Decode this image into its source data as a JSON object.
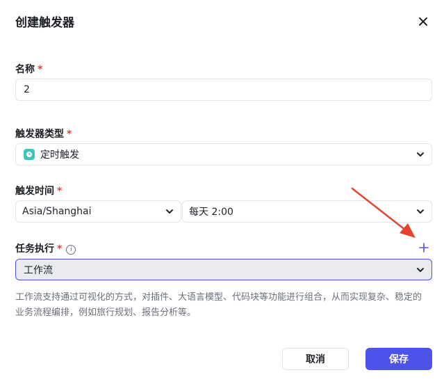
{
  "dialog": {
    "title": "创建触发器",
    "close_icon": "close-icon"
  },
  "form": {
    "name": {
      "label": "名称",
      "required_mark": "*",
      "value": "2"
    },
    "trigger_type": {
      "label": "触发器类型",
      "required_mark": "*",
      "selected": "定时触发",
      "icon": "clock-icon",
      "icon_color": "#3fc6b8"
    },
    "trigger_time": {
      "label": "触发时间",
      "required_mark": "*",
      "timezone": "Asia/Shanghai",
      "schedule": "每天 2:00"
    },
    "task": {
      "label": "任务执行",
      "required_mark": "*",
      "info_icon": "info-icon",
      "add_icon": "plus-icon",
      "selected": "工作流",
      "description": "工作流支持通过可视化的方式，对插件、大语言模型、代码块等功能进行组合，从而实现复杂、稳定的业务流程编排，例如旅行规划、报告分析等。"
    }
  },
  "footer": {
    "cancel_label": "取消",
    "save_label": "保存"
  },
  "colors": {
    "primary": "#4d53e8",
    "required": "#e4423e",
    "annotation_arrow": "#e5432f"
  }
}
